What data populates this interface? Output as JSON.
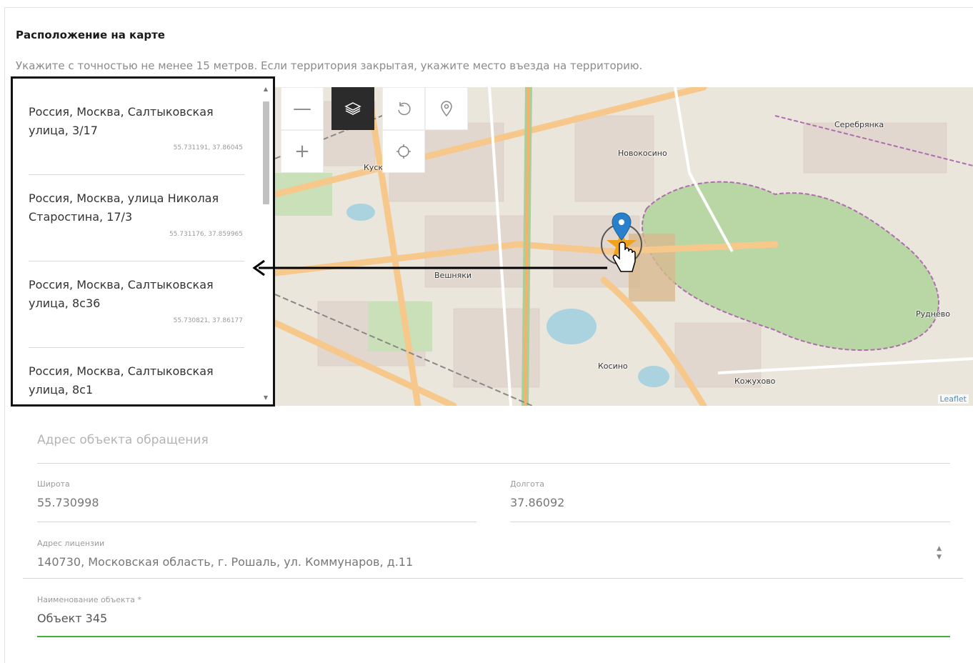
{
  "section": {
    "title": "Расположение на карте",
    "hint": "Укажите с точностью не менее 15 метров. Если территория закрытая, укажите место въезда на территорию."
  },
  "map": {
    "labels": [
      {
        "text": "Серебрянка"
      },
      {
        "text": "Новокосино"
      },
      {
        "text": "Куск"
      },
      {
        "text": "Вешняки"
      },
      {
        "text": "Руднёво"
      },
      {
        "text": "Косино"
      },
      {
        "text": "Кожухово"
      }
    ],
    "attribution": "Leaflet",
    "toolbar": {
      "zoom_out_icon": "minus-icon",
      "layers_icon": "layers-icon",
      "undo_icon": "undo-icon",
      "pin_icon": "map-pin-icon",
      "zoom_in_icon": "plus-icon",
      "locate_icon": "crosshair-icon"
    },
    "colors": {
      "water": "#aad3df",
      "forest": "#add19e",
      "residential": "#e0dfdf",
      "road": "#f9b26c",
      "boundary": "#b06cb0",
      "marker": "#2a81cb"
    }
  },
  "suggestions": [
    {
      "address": "Россия, Москва, Салтыковская улица, 3/17",
      "coords": "55.731191, 37.86045"
    },
    {
      "address": "Россия, Москва, улица Николая Старостина, 17/3",
      "coords": "55.731176, 37.859965"
    },
    {
      "address": "Россия, Москва, Салтыковская улица, 8с36",
      "coords": "55.730821, 37.86177"
    },
    {
      "address": "Россия, Москва, Салтыковская улица, 8с1",
      "coords": ""
    }
  ],
  "form": {
    "address_placeholder": "Адрес объекта обращения",
    "latitude": {
      "label": "Широта",
      "value": "55.730998"
    },
    "longitude": {
      "label": "Долгота",
      "value": "37.86092"
    },
    "license_address": {
      "label": "Адрес лицензии",
      "value": "140730, Московская область, г. Рошаль, ул. Коммунаров, д.11"
    },
    "object_name": {
      "label": "Наименование объекта *",
      "value": "Объект 345"
    }
  }
}
